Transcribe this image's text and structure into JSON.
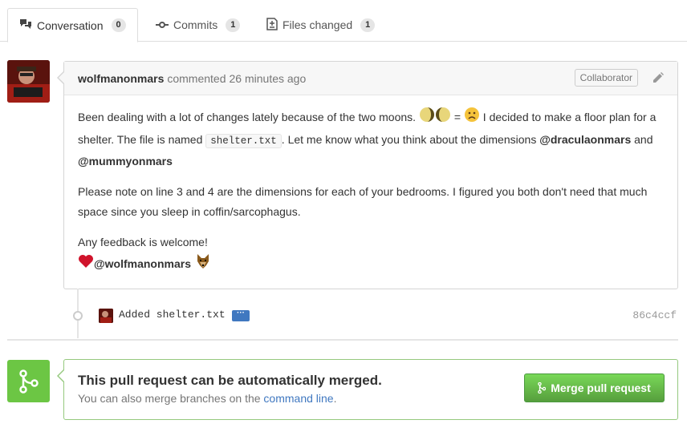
{
  "tabs": [
    {
      "label": "Conversation",
      "count": "0",
      "icon": "comment-discussion-icon"
    },
    {
      "label": "Commits",
      "count": "1",
      "icon": "git-commit-icon"
    },
    {
      "label": "Files changed",
      "count": "1",
      "icon": "file-diff-icon"
    }
  ],
  "comment": {
    "author": "wolfmanonmars",
    "action": "commented",
    "time": "26 minutes ago",
    "badge": "Collaborator",
    "p1_a": "Been dealing with a lot of changes lately because of the two moons.",
    "p1_eq": "=",
    "p1_b": "I decided to make a floor plan for a shelter. The file is named",
    "p1_file": "shelter.txt",
    "p1_c": ". Let me know what you think about the dimensions",
    "mention1": "@draculaonmars",
    "and": "and",
    "mention2": "@mummyonmars",
    "p2": "Please note on line 3 and 4 are the dimensions for each of your bedrooms. I figured you both don't need that much space since you sleep in coffin/sarcophagus.",
    "p3": "Any feedback is welcome!",
    "signature": "@wolfmanonmars"
  },
  "commit": {
    "message": "Added shelter.txt",
    "more": "···",
    "sha": "86c4ccf"
  },
  "merge": {
    "title": "This pull request can be automatically merged.",
    "sub_prefix": "You can also merge branches on the",
    "sub_link": "command line",
    "sub_suffix": ".",
    "button": "Merge pull request"
  },
  "colors": {
    "accent_green": "#6cc644",
    "link_blue": "#4078c0"
  }
}
